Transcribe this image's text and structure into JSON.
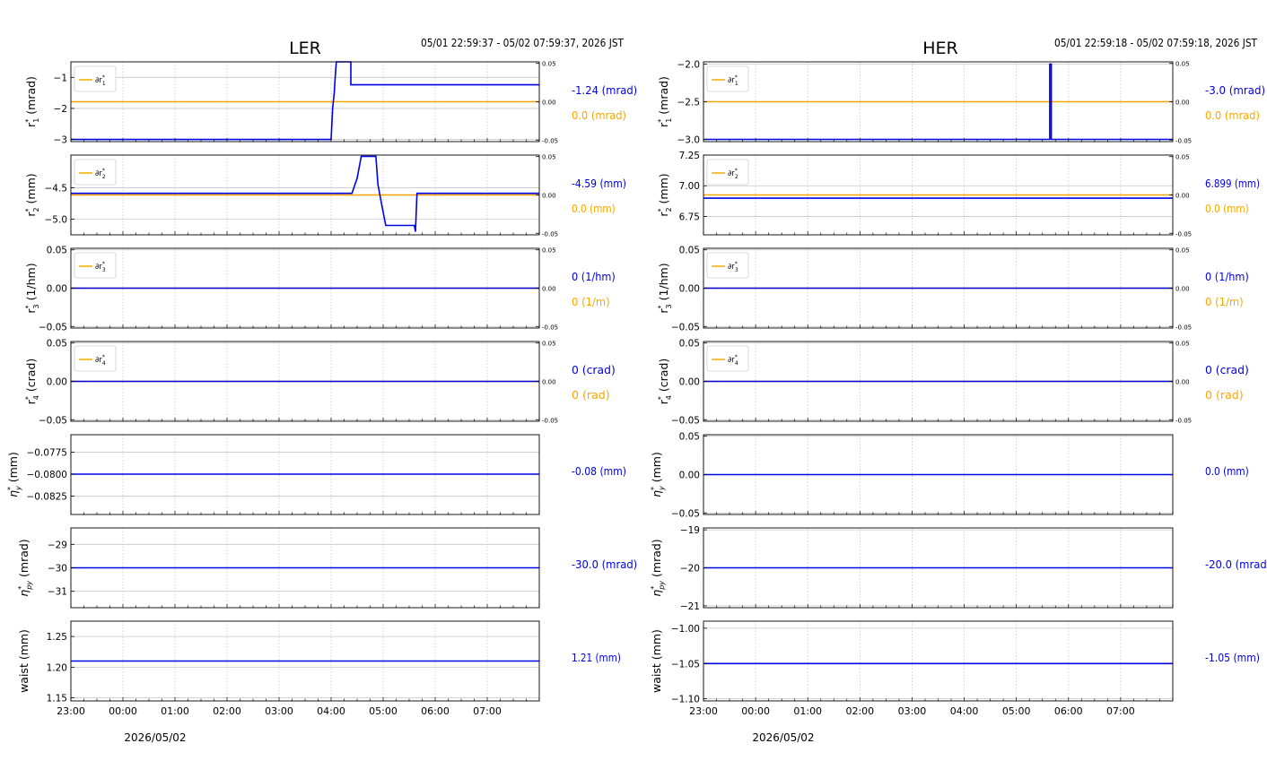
{
  "panels": [
    {
      "title": "LER",
      "time_range": "05/01 22:59:37 - 05/02 07:59:37, 2026 JST",
      "date_label": "2026/05/02",
      "x_ticks": [
        {
          "t": 0,
          "label": "23:00"
        },
        {
          "t": 1,
          "label": "00:00"
        },
        {
          "t": 2,
          "label": "01:00"
        },
        {
          "t": 3,
          "label": "02:00"
        },
        {
          "t": 4,
          "label": "03:00"
        },
        {
          "t": 5,
          "label": "04:00"
        },
        {
          "t": 6,
          "label": "05:00"
        },
        {
          "t": 7,
          "label": "06:00"
        },
        {
          "t": 8,
          "label": "07:00"
        }
      ],
      "rows": [
        {
          "ylabel": "r*1 (mrad)",
          "yticks": [
            {
              "v": -1,
              "label": "−1"
            },
            {
              "v": -2,
              "label": "−2"
            },
            {
              "v": -3,
              "label": "−3"
            }
          ],
          "ylim": [
            -3.07,
            -0.5
          ],
          "legend": "∂r*1",
          "right_ticks": [
            {
              "v": 0.05,
              "label": "0.05"
            },
            {
              "v": 0.0,
              "label": "0.00"
            },
            {
              "v": -0.05,
              "label": "-0.05"
            }
          ],
          "right_ylim": [
            -0.052,
            0.052
          ],
          "blue_series": [
            [
              0,
              -3.0
            ],
            [
              5.0,
              -3.0
            ],
            [
              5.03,
              -2.0
            ],
            [
              5.06,
              -1.5
            ],
            [
              5.08,
              -0.98
            ],
            [
              5.1,
              -0.5
            ],
            [
              5.38,
              -0.5
            ],
            [
              5.38,
              -1.24
            ],
            [
              9.0,
              -1.24
            ]
          ],
          "orange_series": [
            [
              0,
              0.0
            ],
            [
              9.0,
              0.0
            ]
          ],
          "value_blue": "-1.24 (mrad)",
          "value_orange": "0.0 (mrad)"
        },
        {
          "ylabel": "r*2 (mm)",
          "yticks": [
            {
              "v": -4.5,
              "label": "−4.5"
            },
            {
              "v": -5.0,
              "label": "−5.0"
            }
          ],
          "ylim": [
            -5.25,
            -3.98
          ],
          "legend": "∂r*2",
          "right_ticks": [
            {
              "v": 0.05,
              "label": "0.05"
            },
            {
              "v": 0.0,
              "label": "0.00"
            },
            {
              "v": -0.05,
              "label": "-0.05"
            }
          ],
          "right_ylim": [
            -0.052,
            0.052
          ],
          "blue_series": [
            [
              0,
              -4.59
            ],
            [
              5.4,
              -4.59
            ],
            [
              5.5,
              -4.35
            ],
            [
              5.58,
              -4.0
            ],
            [
              5.86,
              -4.0
            ],
            [
              5.9,
              -4.45
            ],
            [
              5.98,
              -4.8
            ],
            [
              6.05,
              -5.1
            ],
            [
              6.6,
              -5.1
            ],
            [
              6.62,
              -5.2
            ],
            [
              6.65,
              -4.59
            ],
            [
              9.0,
              -4.59
            ]
          ],
          "orange_series": [
            [
              0,
              0.0
            ],
            [
              9.0,
              0.0
            ]
          ],
          "value_blue": "-4.59 (mm)",
          "value_orange": "0.0 (mm)"
        },
        {
          "ylabel": "r*3 (1/hm)",
          "yticks": [
            {
              "v": 0.05,
              "label": "0.05"
            },
            {
              "v": 0.0,
              "label": "0.00"
            },
            {
              "v": -0.05,
              "label": "−0.05"
            }
          ],
          "ylim": [
            -0.052,
            0.052
          ],
          "legend": "∂r*3",
          "right_ticks": [
            {
              "v": 0.05,
              "label": "0.05"
            },
            {
              "v": 0.0,
              "label": "0.00"
            },
            {
              "v": -0.05,
              "label": "-0.05"
            }
          ],
          "right_ylim": [
            -0.052,
            0.052
          ],
          "blue_series": [
            [
              0,
              0.0
            ],
            [
              9.0,
              0.0
            ]
          ],
          "orange_series": [
            [
              0,
              0.0
            ],
            [
              9.0,
              0.0
            ]
          ],
          "value_blue": "0 (1/hm)",
          "value_orange": "0 (1/m)"
        },
        {
          "ylabel": "r*4 (crad)",
          "yticks": [
            {
              "v": 0.05,
              "label": "0.05"
            },
            {
              "v": 0.0,
              "label": "0.00"
            },
            {
              "v": -0.05,
              "label": "−0.05"
            }
          ],
          "ylim": [
            -0.052,
            0.052
          ],
          "legend": "∂r*4",
          "right_ticks": [
            {
              "v": 0.05,
              "label": "0.05"
            },
            {
              "v": 0.0,
              "label": "0.00"
            },
            {
              "v": -0.05,
              "label": "-0.05"
            }
          ],
          "right_ylim": [
            -0.052,
            0.052
          ],
          "blue_series": [
            [
              0,
              0.0
            ],
            [
              9.0,
              0.0
            ]
          ],
          "orange_series": [
            [
              0,
              0.0
            ],
            [
              9.0,
              0.0
            ]
          ],
          "value_blue": "0 (crad)",
          "value_orange": "0 (rad)"
        },
        {
          "ylabel": "η*y (mm)",
          "yticks": [
            {
              "v": -0.0775,
              "label": "−0.0775"
            },
            {
              "v": -0.08,
              "label": "−0.0800"
            },
            {
              "v": -0.0825,
              "label": "−0.0825"
            }
          ],
          "ylim": [
            -0.0846,
            -0.0755
          ],
          "legend": "",
          "blue_series": [
            [
              0,
              -0.08
            ],
            [
              9.0,
              -0.08
            ]
          ],
          "value_blue": "-0.08 (mm)",
          "value_orange": ""
        },
        {
          "ylabel": "η*py (mrad)",
          "yticks": [
            {
              "v": -29,
              "label": "−29"
            },
            {
              "v": -30,
              "label": "−30"
            },
            {
              "v": -31,
              "label": "−31"
            }
          ],
          "ylim": [
            -31.7,
            -28.3
          ],
          "legend": "",
          "blue_series": [
            [
              0,
              -30.0
            ],
            [
              9.0,
              -30.0
            ]
          ],
          "value_blue": "-30.0 (mrad)",
          "value_orange": ""
        },
        {
          "ylabel": "waist (mm)",
          "yticks": [
            {
              "v": 1.25,
              "label": "1.25"
            },
            {
              "v": 1.2,
              "label": "1.20"
            },
            {
              "v": 1.15,
              "label": "1.15"
            }
          ],
          "ylim": [
            1.145,
            1.275
          ],
          "legend": "",
          "blue_series": [
            [
              0,
              1.21
            ],
            [
              9.0,
              1.21
            ]
          ],
          "value_blue": "1.21 (mm)",
          "value_orange": ""
        }
      ]
    },
    {
      "title": "HER",
      "time_range": "05/01 22:59:18 - 05/02 07:59:18, 2026 JST",
      "date_label": "2026/05/02",
      "x_ticks": [
        {
          "t": 0,
          "label": "23:00"
        },
        {
          "t": 1,
          "label": "00:00"
        },
        {
          "t": 2,
          "label": "01:00"
        },
        {
          "t": 3,
          "label": "02:00"
        },
        {
          "t": 4,
          "label": "03:00"
        },
        {
          "t": 5,
          "label": "04:00"
        },
        {
          "t": 6,
          "label": "05:00"
        },
        {
          "t": 7,
          "label": "06:00"
        },
        {
          "t": 8,
          "label": "07:00"
        }
      ],
      "rows": [
        {
          "ylabel": "r*1 (mrad)",
          "yticks": [
            {
              "v": -2.0,
              "label": "−2.0"
            },
            {
              "v": -2.5,
              "label": "−2.5"
            },
            {
              "v": -3.0,
              "label": "−3.0"
            }
          ],
          "ylim": [
            -3.03,
            -1.97
          ],
          "legend": "∂r*1",
          "right_ticks": [
            {
              "v": 0.05,
              "label": "0.05"
            },
            {
              "v": 0.0,
              "label": "0.00"
            },
            {
              "v": -0.05,
              "label": "-0.05"
            }
          ],
          "right_ylim": [
            -0.052,
            0.052
          ],
          "blue_series": [
            [
              0,
              -3.0
            ],
            [
              6.64,
              -3.0
            ],
            [
              6.64,
              -2.0
            ],
            [
              6.67,
              -2.0
            ],
            [
              6.67,
              -3.0
            ],
            [
              9.0,
              -3.0
            ]
          ],
          "orange_series": [
            [
              0,
              0.0
            ],
            [
              9.0,
              0.0
            ]
          ],
          "value_blue": "-3.0 (mrad)",
          "value_orange": "0.0 (mrad)"
        },
        {
          "ylabel": "r*2 (mm)",
          "yticks": [
            {
              "v": 7.25,
              "label": "7.25"
            },
            {
              "v": 7.0,
              "label": "7.00"
            },
            {
              "v": 6.75,
              "label": "6.75"
            }
          ],
          "ylim": [
            6.6,
            7.25
          ],
          "legend": "∂r*2",
          "right_ticks": [
            {
              "v": 0.05,
              "label": "0.05"
            },
            {
              "v": 0.0,
              "label": "0.00"
            },
            {
              "v": -0.05,
              "label": "-0.05"
            }
          ],
          "right_ylim": [
            -0.052,
            0.052
          ],
          "blue_series": [
            [
              0,
              6.899
            ],
            [
              9.0,
              6.899
            ]
          ],
          "orange_series": [
            [
              0,
              0.0
            ],
            [
              9.0,
              0.0
            ]
          ],
          "value_blue": "6.899 (mm)",
          "value_orange": "0.0 (mm)"
        },
        {
          "ylabel": "r*3 (1/hm)",
          "yticks": [
            {
              "v": 0.05,
              "label": "0.05"
            },
            {
              "v": 0.0,
              "label": "0.00"
            },
            {
              "v": -0.05,
              "label": "−0.05"
            }
          ],
          "ylim": [
            -0.052,
            0.052
          ],
          "legend": "∂r*3",
          "right_ticks": [
            {
              "v": 0.05,
              "label": "0.05"
            },
            {
              "v": 0.0,
              "label": "0.00"
            },
            {
              "v": -0.05,
              "label": "-0.05"
            }
          ],
          "right_ylim": [
            -0.052,
            0.052
          ],
          "blue_series": [
            [
              0,
              0.0
            ],
            [
              9.0,
              0.0
            ]
          ],
          "orange_series": [
            [
              0,
              0.0
            ],
            [
              9.0,
              0.0
            ]
          ],
          "value_blue": "0 (1/hm)",
          "value_orange": "0 (1/m)"
        },
        {
          "ylabel": "r*4 (crad)",
          "yticks": [
            {
              "v": 0.05,
              "label": "0.05"
            },
            {
              "v": 0.0,
              "label": "0.00"
            },
            {
              "v": -0.05,
              "label": "−0.05"
            }
          ],
          "ylim": [
            -0.052,
            0.052
          ],
          "legend": "∂r*4",
          "right_ticks": [
            {
              "v": 0.05,
              "label": "0.05"
            },
            {
              "v": 0.0,
              "label": "0.00"
            },
            {
              "v": -0.05,
              "label": "-0.05"
            }
          ],
          "right_ylim": [
            -0.052,
            0.052
          ],
          "blue_series": [
            [
              0,
              0.0
            ],
            [
              9.0,
              0.0
            ]
          ],
          "orange_series": [
            [
              0,
              0.0
            ],
            [
              9.0,
              0.0
            ]
          ],
          "value_blue": "0 (crad)",
          "value_orange": "0 (rad)"
        },
        {
          "ylabel": "η*y (mm)",
          "yticks": [
            {
              "v": 0.05,
              "label": "0.05"
            },
            {
              "v": 0.0,
              "label": "0.00"
            },
            {
              "v": -0.05,
              "label": "−0.05"
            }
          ],
          "ylim": [
            -0.052,
            0.052
          ],
          "legend": "",
          "blue_series": [
            [
              0,
              0.0
            ],
            [
              9.0,
              0.0
            ]
          ],
          "value_blue": "0.0 (mm)",
          "value_orange": ""
        },
        {
          "ylabel": "η*py (mrad)",
          "yticks": [
            {
              "v": -19,
              "label": "−19"
            },
            {
              "v": -20,
              "label": "−20"
            },
            {
              "v": -21,
              "label": "−21"
            }
          ],
          "ylim": [
            -21.05,
            -18.95
          ],
          "legend": "",
          "blue_series": [
            [
              0,
              -20.0
            ],
            [
              9.0,
              -20.0
            ]
          ],
          "value_blue": "-20.0 (mrad)",
          "value_orange": ""
        },
        {
          "ylabel": "waist (mm)",
          "yticks": [
            {
              "v": -1.0,
              "label": "−1.00"
            },
            {
              "v": -1.05,
              "label": "−1.05"
            },
            {
              "v": -1.1,
              "label": "−1.10"
            }
          ],
          "ylim": [
            -1.103,
            -0.99
          ],
          "legend": "",
          "blue_series": [
            [
              0,
              -1.05
            ],
            [
              9.0,
              -1.05
            ]
          ],
          "value_blue": "-1.05 (mm)",
          "value_orange": ""
        }
      ]
    }
  ],
  "colors": {
    "blue": "#0000e6",
    "orange": "#ffa500",
    "grid": "#c8c8c8",
    "axis": "#000000"
  },
  "chart_data": [
    {
      "type": "line",
      "title": "LER",
      "subtitle": "05/01 22:59:37 - 05/02 07:59:37, 2026 JST",
      "x": [
        "23:00",
        "00:00",
        "01:00",
        "02:00",
        "03:00",
        "04:00",
        "05:00",
        "06:00",
        "07:00"
      ],
      "xlabel": "2026/05/02",
      "series": [
        {
          "name": "r*1 (mrad)",
          "latest": -1.24
        },
        {
          "name": "∂r*1",
          "latest": 0.0
        },
        {
          "name": "r*2 (mm)",
          "latest": -4.59
        },
        {
          "name": "∂r*2",
          "latest": 0.0
        },
        {
          "name": "r*3 (1/hm)",
          "latest": 0
        },
        {
          "name": "∂r*3",
          "latest": 0
        },
        {
          "name": "r*4 (crad)",
          "latest": 0
        },
        {
          "name": "∂r*4",
          "latest": 0
        },
        {
          "name": "η*y (mm)",
          "latest": -0.08
        },
        {
          "name": "η*py (mrad)",
          "latest": -30.0
        },
        {
          "name": "waist (mm)",
          "latest": 1.21
        }
      ],
      "grid": true,
      "legend": "upper-left"
    },
    {
      "type": "line",
      "title": "HER",
      "subtitle": "05/01 22:59:18 - 05/02 07:59:18, 2026 JST",
      "x": [
        "23:00",
        "00:00",
        "01:00",
        "02:00",
        "03:00",
        "04:00",
        "05:00",
        "06:00",
        "07:00"
      ],
      "xlabel": "2026/05/02",
      "series": [
        {
          "name": "r*1 (mrad)",
          "latest": -3.0
        },
        {
          "name": "∂r*1",
          "latest": 0.0
        },
        {
          "name": "r*2 (mm)",
          "latest": 6.899
        },
        {
          "name": "∂r*2",
          "latest": 0.0
        },
        {
          "name": "r*3 (1/hm)",
          "latest": 0
        },
        {
          "name": "∂r*3",
          "latest": 0
        },
        {
          "name": "r*4 (crad)",
          "latest": 0
        },
        {
          "name": "∂r*4",
          "latest": 0
        },
        {
          "name": "η*y (mm)",
          "latest": 0.0
        },
        {
          "name": "η*py (mrad)",
          "latest": -20.0
        },
        {
          "name": "waist (mm)",
          "latest": -1.05
        }
      ],
      "grid": true,
      "legend": "upper-left"
    }
  ]
}
